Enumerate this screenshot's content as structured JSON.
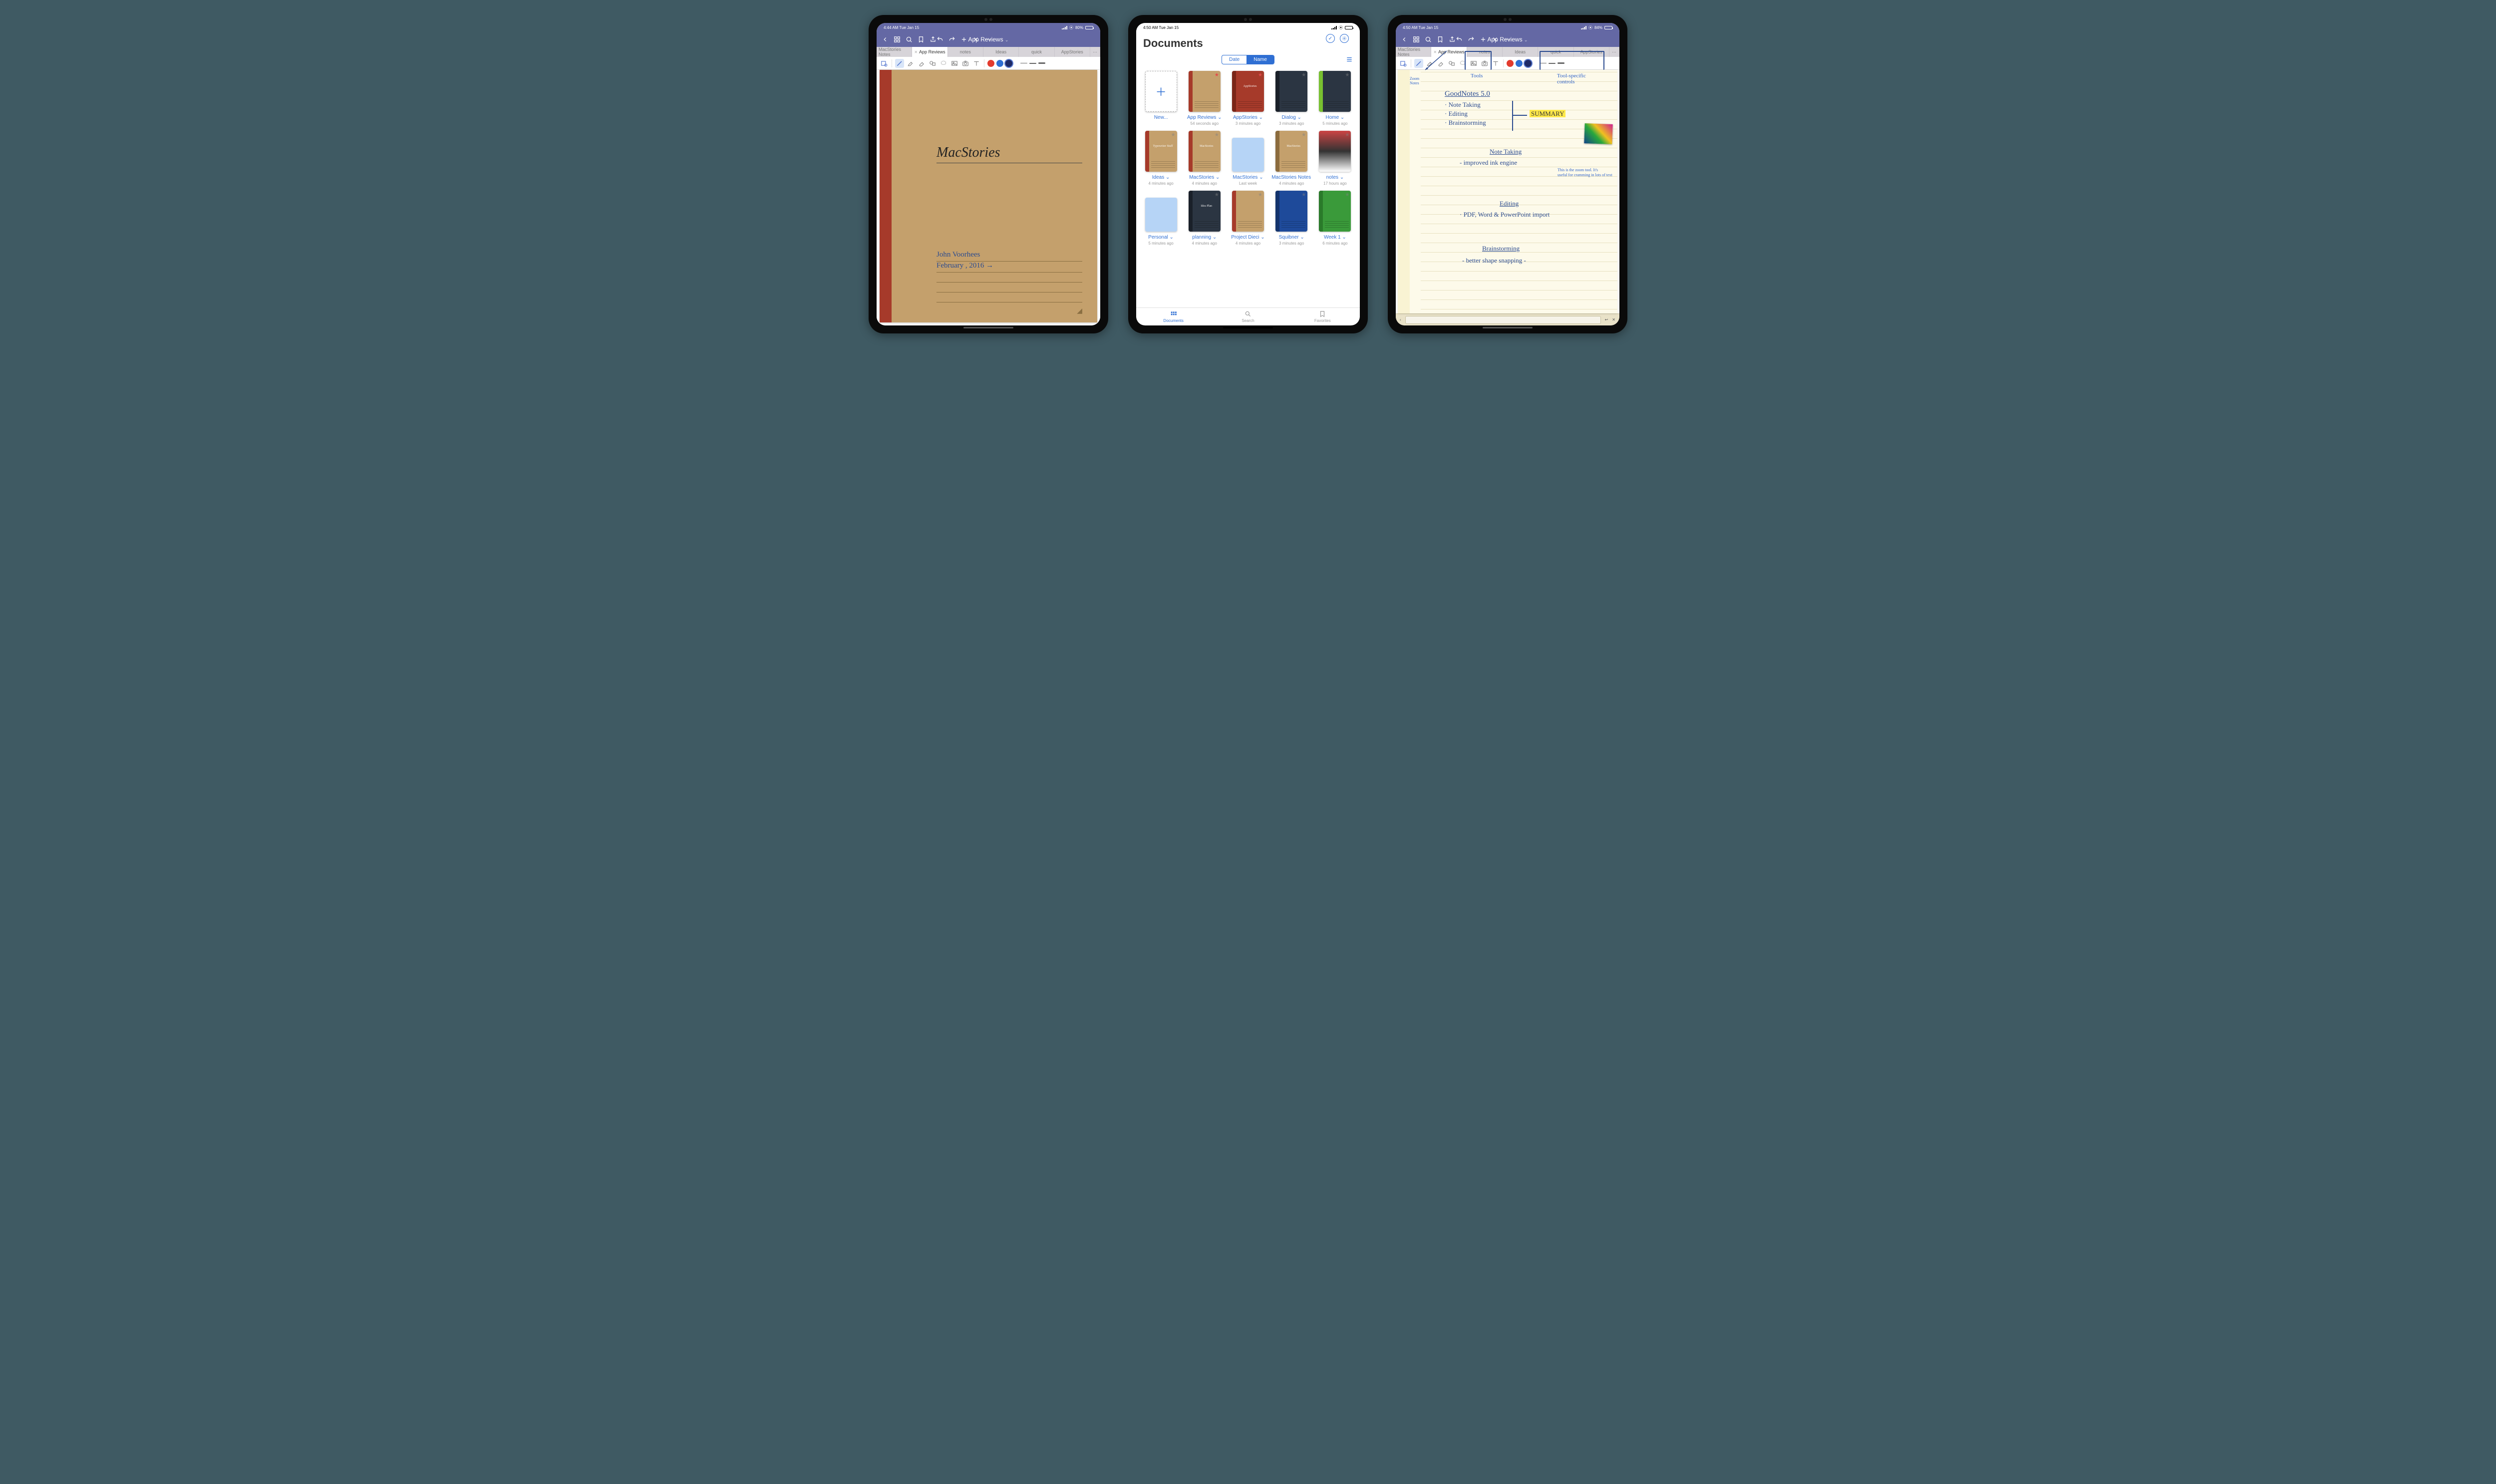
{
  "status": {
    "left_time_1": "4:44 AM   Tue Jan 15",
    "left_time_2": "4:50 AM   Tue Jan 15",
    "left_time_3": "4:50 AM   Tue Jan 15",
    "battery_1": "80%",
    "battery_3": "84%"
  },
  "nav": {
    "title": "App Reviews",
    "tabs": [
      "MacStories Notes",
      "App Reviews",
      "notes",
      "Ideas",
      "quick",
      "AppStories"
    ]
  },
  "toolbar_colors": [
    "#e33b2e",
    "#2f6fd3",
    "#1e2a66"
  ],
  "cover": {
    "title": "MacStories",
    "author": "John Voorhees",
    "date": "February , 2016 →"
  },
  "docs_page": {
    "title": "Documents",
    "seg": [
      "Date",
      "Name"
    ],
    "bottom_tabs": [
      "Documents",
      "Search",
      "Favorites"
    ]
  },
  "docs": [
    {
      "name": "New...",
      "date": "",
      "type": "new"
    },
    {
      "name": "App Reviews",
      "date": "54 seconds ago",
      "type": "nb",
      "bg": "#c4a06c",
      "spine": "#a63a2a",
      "fav": true
    },
    {
      "name": "AppStories",
      "date": "3 minutes ago",
      "type": "nb",
      "bg": "#a63a2a",
      "spine": "#7a2618",
      "fav": true,
      "labelTop": "AppStories"
    },
    {
      "name": "Dialog",
      "date": "3 minutes ago",
      "type": "nb",
      "bg": "#2b3542",
      "spine": "#1a2029"
    },
    {
      "name": "Home",
      "date": "5 minutes ago",
      "type": "nb",
      "bg": "#2b3542",
      "spine": "#78c030"
    },
    {
      "name": "Ideas",
      "date": "4 minutes ago",
      "type": "nb",
      "bg": "#c4a06c",
      "spine": "#a63a2a",
      "labelTop": "Typewriter Stuff"
    },
    {
      "name": "MacStories",
      "date": "4 minutes ago",
      "type": "nb",
      "bg": "#c4a06c",
      "spine": "#a63a2a",
      "labelTop": "MacStories"
    },
    {
      "name": "MacStories",
      "date": "Last week",
      "type": "folder"
    },
    {
      "name": "MacStories Notes",
      "date": "4 minutes ago",
      "type": "nb",
      "bg": "#c4a06c",
      "spine": "#8c6c3e",
      "labelTop": "MacStories"
    },
    {
      "name": "notes",
      "date": "17 hours ago",
      "type": "page"
    },
    {
      "name": "Personal",
      "date": "5 minutes ago",
      "type": "folder"
    },
    {
      "name": "planning",
      "date": "4 minutes ago",
      "type": "nb",
      "bg": "#2b3542",
      "spine": "#1a2029",
      "labelTop": "Idea Plan"
    },
    {
      "name": "Project Dieci",
      "date": "4 minutes ago",
      "type": "nb",
      "bg": "#c4a06c",
      "spine": "#a63a2a"
    },
    {
      "name": "Squibner",
      "date": "3 minutes ago",
      "type": "nb",
      "bg": "#1e4a9a",
      "spine": "#14346d"
    },
    {
      "name": "Week 1",
      "date": "6 minutes ago",
      "type": "nb",
      "bg": "#3a9a3a",
      "spine": "#2a7a2a"
    }
  ],
  "note": {
    "Tools_label": "Tools",
    "zoom_label": "Zoom\nNotes",
    "tool_specific": "Tool-specific\ncontrols",
    "title_line": "GoodNotes 5.0",
    "bullets": [
      "· Note Taking",
      "· Editing",
      "· Brainstorming"
    ],
    "summary": "SUMMARY",
    "h_note": "Note Taking",
    "l1": "- improved ink engine",
    "zoom_note": "This is the zoom tool. It's\nuseful for cramming in lots of text",
    "h_edit": "Editing",
    "l2": "· PDF, Word & PowerPoint import",
    "h_bs": "Brainstorming",
    "l3": "- better shape snapping -"
  }
}
